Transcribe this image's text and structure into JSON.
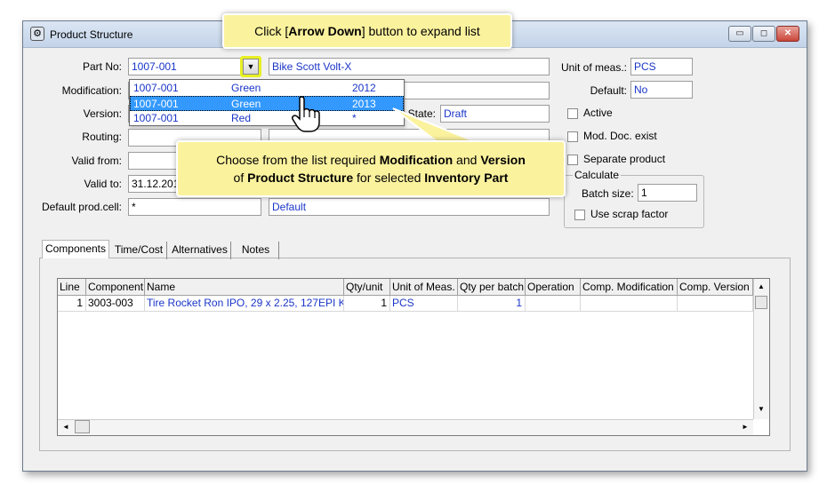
{
  "window": {
    "title": "Product Structure",
    "icon": "product-structure-icon"
  },
  "titlebar_buttons": {
    "minimize": "▭",
    "maximize": "◻",
    "close": "✕"
  },
  "form": {
    "part_no_label": "Part No:",
    "part_no_value": "1007-001",
    "part_desc": "Bike Scott Volt-X",
    "modification_label": "Modification:",
    "version_label": "Version:",
    "state_label": "State:",
    "state_value": "Draft",
    "routing_label": "Routing:",
    "valid_from_label": "Valid from:",
    "valid_to_label": "Valid to:",
    "valid_to_value": "31.12.201",
    "default_prod_cell_label": "Default prod.cell:",
    "default_prod_cell_value": "*",
    "default_prod_cell_desc": "Default",
    "unit_label": "Unit of meas.:",
    "unit_value": "PCS",
    "default_label": "Default:",
    "default_value": "No",
    "active_label": "Active",
    "mod_doc_label": "Mod. Doc. exist",
    "separate_label": "Separate product",
    "calculate_label": "Calculate",
    "batch_size_label": "Batch size:",
    "batch_size_value": "1",
    "scrap_label": "Use scrap factor"
  },
  "dropdown": {
    "rows": [
      {
        "part": "1007-001",
        "modification": "Green",
        "version": "2012"
      },
      {
        "part": "1007-001",
        "modification": "Green",
        "version": "2013"
      },
      {
        "part": "1007-001",
        "modification": "Red",
        "version": "*"
      }
    ],
    "selected_index": 1
  },
  "callouts": {
    "top": {
      "pre": "Click [",
      "bold": "Arrow Down",
      "post": "] button to expand list"
    },
    "middle": {
      "l1_a": "Choose from the list required ",
      "l1_b": "Modification",
      "l1_c": " and ",
      "l1_d": "Version",
      "l2_a": "of ",
      "l2_b": "Product Structure",
      "l2_c": " for selected ",
      "l2_d": "Inventory Part"
    }
  },
  "tabs": [
    "Components",
    "Time/Cost",
    "Alternatives",
    "Notes"
  ],
  "grid": {
    "headers": [
      "Line",
      "Component",
      "Name",
      "Qty/unit",
      "Unit of Meas.",
      "Qty per batch",
      "Operation",
      "Comp. Modification",
      "Comp. Version"
    ],
    "rows": [
      [
        "1",
        "3003-003",
        "Tire Rocket Ron IPO, 29 x 2.25, 127EPI K",
        "1",
        "PCS",
        "1",
        "",
        "",
        ""
      ]
    ]
  },
  "scroll": {
    "up": "▲",
    "down": "▼",
    "left": "◄",
    "right": "►"
  }
}
